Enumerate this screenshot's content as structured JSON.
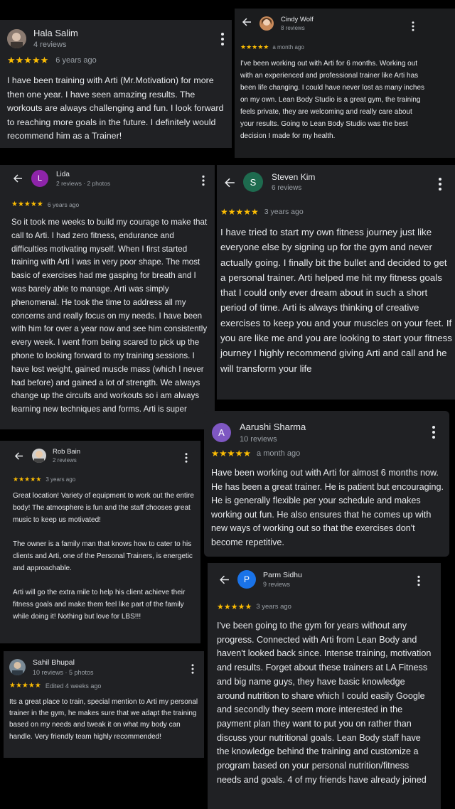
{
  "reviews": {
    "hala": {
      "name": "Hala Salim",
      "meta": "4 reviews",
      "stars": "★★★★★",
      "time": "6 years ago",
      "text": "I have been training with Arti (Mr.Motivation) for more then one year. I have seen amazing results. The workouts are always challenging and fun. I look forward to reaching more goals in the future. I definitely would recommend him as a Trainer!"
    },
    "cindy": {
      "name": "Cindy Wolf",
      "meta": "8 reviews",
      "stars": "★★★★★",
      "time": "a month ago",
      "text": "I've been working out with Arti for 6 months. Working out with an experienced and professional trainer like Arti has been life changing. I could have never lost as many inches on my own. Lean Body Studio is a great gym, the training feels private, they are welcoming and really care about your results. Going to Lean Body Studio was the best decision I made for my health."
    },
    "lida": {
      "name": "Lida",
      "initial": "L",
      "meta": "2 reviews · 2 photos",
      "stars": "★★★★★",
      "time": "6 years ago",
      "text": "So it took me weeks to build my courage to make that call to Arti. I had zero fitness, endurance and difficulties motivating myself. When I first started training with Arti I was in very poor shape. The most basic of exercises had me gasping for breath and I was barely able to manage. Arti was simply phenomenal. He took the time to address all my concerns and really focus on my needs. I have been with him for over a year now and see him consistently every week. I went from being scared to pick up the phone to looking forward to my training sessions. I have lost weight, gained muscle mass (which I never had before) and gained a lot of strength. We always change up the circuits and workouts so i am always learning new techniques and forms. Arti is super"
    },
    "steven": {
      "name": "Steven Kim",
      "initial": "S",
      "meta": "6 reviews",
      "stars": "★★★★★",
      "time": "3 years ago",
      "text": "I have tried to start my own fitness journey just like everyone else by signing up for the gym and never actually going. I finally bit the bullet and decided to get a personal trainer. Arti helped me hit my fitness goals that I could only ever dream about in such a short period of time. Arti is always thinking of creative exercises to keep you and your muscles on your feet. If you are like me and you are looking to start your fitness journey I highly recommend giving Arti and call and he will transform your life"
    },
    "rob": {
      "name": "Rob Bain",
      "meta": "2 reviews",
      "stars": "★★★★★",
      "time": "3 years ago",
      "text": "Great location! Variety of equipment to work out the entire body! The atmosphere is fun and the staff chooses great music to keep us motivated!\n\nThe owner is a family man that knows how to cater to his clients and Arti, one of the Personal Trainers, is energetic and approachable.\n\nArti will go the extra mile to help his client achieve their fitness goals and make them feel like part of the family while doing it! Nothing but love for LBS!!!"
    },
    "aarushi": {
      "name": "Aarushi Sharma",
      "initial": "A",
      "meta": "10 reviews",
      "stars": "★★★★★",
      "time": "a month ago",
      "text": "Have been working out with Arti for almost 6 months now. He has been a great trainer. He is patient but encouraging. He is generally flexible per your schedule and makes working out fun. He also ensures that he comes up with new ways of working out so that the exercises don't become repetitive."
    },
    "sahil": {
      "name": "Sahil Bhupal",
      "meta": "10 reviews · 5 photos",
      "stars": "★★★★★",
      "time": "Edited 4 weeks ago",
      "text": "Its a great place to train, special mention to Arti my personal trainer in the gym, he makes sure that we adapt the training based on my needs and tweak it on what my body can handle. Very friendly team highly recommended!"
    },
    "parm": {
      "name": "Parm Sidhu",
      "initial": "P",
      "meta": "9 reviews",
      "stars": "★★★★★",
      "time": "3 years ago",
      "text": "I've been going to the gym for years without any progress. Connected with Arti from Lean Body and haven't looked back since. Intense training, motivation and results. Forget about these trainers at LA Fitness and big name guys, they have basic knowledge around nutrition to share which I could easily Google and secondly they seem more interested in the payment plan they want to put you on rather than discuss your nutritional goals. Lean Body staff have the knowledge behind the training and customize a program based on your personal nutrition/fitness needs and goals. 4 of my friends have already joined"
    }
  },
  "icons": {
    "back": "arrow-left-icon",
    "more": "more-vert-icon",
    "star": "star-icon"
  },
  "colors": {
    "star": "#fbbc04",
    "lida_avatar": "#8e24aa",
    "steven_avatar": "#1e6b4f",
    "aarushi_avatar": "#7e57c2",
    "parm_avatar": "#1a73e8"
  }
}
